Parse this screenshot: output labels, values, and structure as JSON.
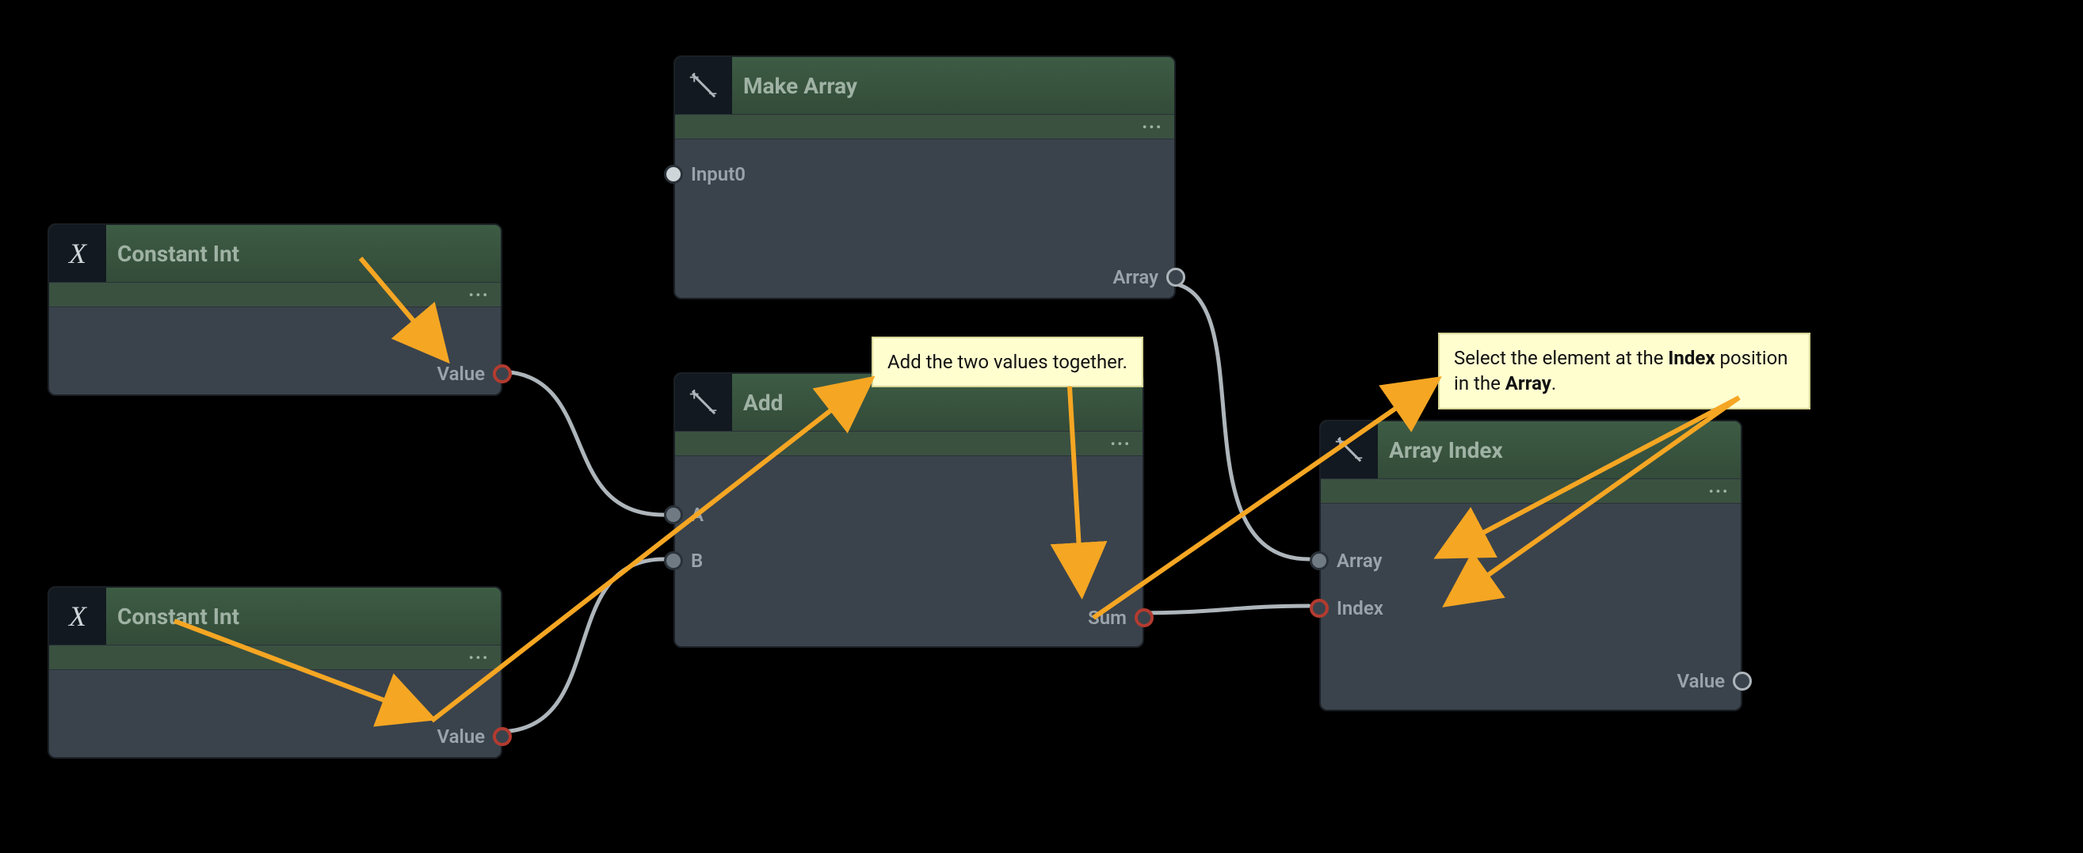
{
  "nodes": {
    "const_int_1": {
      "title": "Constant Int",
      "icon_text": "X",
      "outputs": {
        "value": "Value"
      }
    },
    "const_int_2": {
      "title": "Constant Int",
      "icon_text": "X",
      "outputs": {
        "value": "Value"
      }
    },
    "make_array": {
      "title": "Make Array",
      "inputs": {
        "input0": "Input0"
      },
      "outputs": {
        "array": "Array"
      }
    },
    "add": {
      "title": "Add",
      "inputs": {
        "a": "A",
        "b": "B"
      },
      "outputs": {
        "sum": "Sum"
      }
    },
    "array_index": {
      "title": "Array Index",
      "inputs": {
        "array": "Array",
        "index": "Index"
      },
      "outputs": {
        "value": "Value"
      }
    }
  },
  "tooltips": {
    "add": "Add the two values together.",
    "array_index_pre": "Select the element at the ",
    "array_index_mid1": "Index",
    "array_index_mid2": " position in the ",
    "array_index_mid3": "Array",
    "array_index_post": "."
  },
  "menu_dots": "•••",
  "colors": {
    "wire": "#aeb6bb",
    "arrow": "#f5a623",
    "tooltip_bg": "#fffecf",
    "node_header": "#3d5c44",
    "node_body": "#3a434c"
  }
}
